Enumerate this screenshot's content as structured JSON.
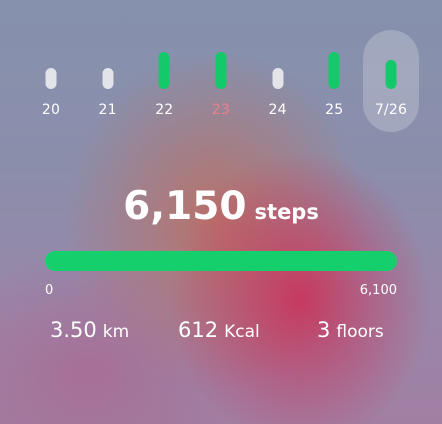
{
  "days": [
    {
      "label": "20",
      "state": "empty",
      "today": false,
      "selected": false
    },
    {
      "label": "21",
      "state": "empty",
      "today": false,
      "selected": false
    },
    {
      "label": "22",
      "state": "full",
      "today": false,
      "selected": false
    },
    {
      "label": "23",
      "state": "full",
      "today": true,
      "selected": false
    },
    {
      "label": "24",
      "state": "empty",
      "today": false,
      "selected": false
    },
    {
      "label": "25",
      "state": "full",
      "today": false,
      "selected": false
    },
    {
      "label": "7/26",
      "state": "partial",
      "today": false,
      "selected": true
    }
  ],
  "summary": {
    "steps": "6,150",
    "steps_unit": "steps",
    "goal_min": "0",
    "goal_max": "6,100",
    "progress_fraction": 1.0
  },
  "stats": {
    "distance": {
      "value": "3.50",
      "unit": "km"
    },
    "calories": {
      "value": "612",
      "unit": "Kcal"
    },
    "floors": {
      "value": "3",
      "unit": "floors"
    }
  },
  "colors": {
    "bar_complete": "#14c96a",
    "bar_empty": "#e3e3ea",
    "today_label": "#e8808a",
    "progress_fill": "#14cf6c"
  }
}
